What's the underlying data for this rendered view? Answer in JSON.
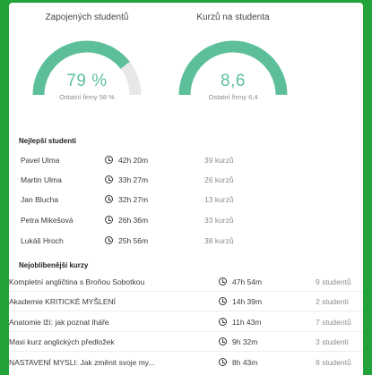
{
  "colors": {
    "background": "#21a33a",
    "gauge_fill": "#5dbf9a",
    "gauge_track": "#e8e8e8"
  },
  "gauges": [
    {
      "title": "Zapojených studentů",
      "value": "79 %",
      "sub": "Ostatní firmy 58 %",
      "fill_fraction": 0.79
    },
    {
      "title": "Kurzů na studenta",
      "value": "8,6",
      "sub": "Ostatní firmy 6,4",
      "fill_fraction": 1.0
    }
  ],
  "best_students": {
    "title": "Nejlepší studenti",
    "rows": [
      {
        "name": "Pavel Ulma",
        "time": "42h 20m",
        "courses": "39 kurzů"
      },
      {
        "name": "Martin Ulma",
        "time": "33h 27m",
        "courses": "26 kurzů"
      },
      {
        "name": "Jan Blucha",
        "time": "32h 27m",
        "courses": "13 kurzů"
      },
      {
        "name": "Petra Mikešová",
        "time": "26h 36m",
        "courses": "33 kurzů"
      },
      {
        "name": "Lukáš Hroch",
        "time": "25h 56m",
        "courses": "38 kurzů"
      }
    ]
  },
  "popular_courses": {
    "title": "Nejoblíbenější kurzy",
    "rows": [
      {
        "name": "Kompletní angličtina s Broňou Sobotkou",
        "time": "47h 54m",
        "students": "9 studentů"
      },
      {
        "name": "Akademie KRITICKÉ MYŠLENÍ",
        "time": "14h 39m",
        "students": "2 studenti"
      },
      {
        "name": "Anatomie lží: jak poznat lháře",
        "time": "11h 43m",
        "students": "7 studentů"
      },
      {
        "name": "Maxi kurz anglických předložek",
        "time": "9h 32m",
        "students": "3 studenti"
      },
      {
        "name": "NASTAVENÍ MYSLI: Jak změnit svoje my...",
        "time": "8h 43m",
        "students": "8 studentů"
      }
    ]
  }
}
